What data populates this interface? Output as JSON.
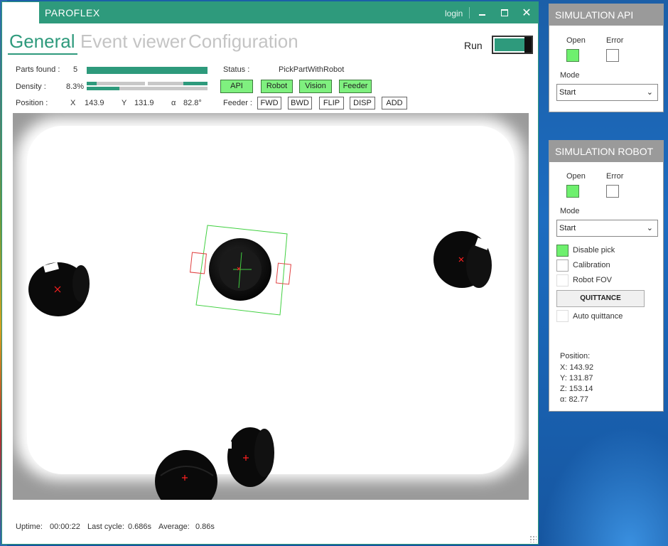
{
  "main_window": {
    "title": "PAROFLEX",
    "login_label": "login",
    "close_glyph": "✕"
  },
  "tabs": [
    {
      "label": "General",
      "active": true
    },
    {
      "label": "Event viewer",
      "active": false
    },
    {
      "label": "Configuration",
      "active": false
    }
  ],
  "run": {
    "label": "Run",
    "state": "on"
  },
  "stats": {
    "parts_found_label": "Parts found :",
    "parts_found_value": "5",
    "parts_found_level": 1.0,
    "density_label": "Density :",
    "density_value": "8.3%",
    "position_label": "Position :",
    "x_label": "X",
    "x_value": "143.9",
    "y_label": "Y",
    "y_value": "131.9",
    "a_label": "α",
    "a_value": "82.8°"
  },
  "status": {
    "label": "Status :",
    "value": "PickPartWithRobot",
    "indicators": [
      "API",
      "Robot",
      "Vision",
      "Feeder"
    ]
  },
  "feeder": {
    "label": "Feeder :",
    "buttons": [
      "FWD",
      "BWD",
      "FLIP",
      "DISP",
      "ADD"
    ]
  },
  "footer": {
    "uptime_label": "Uptime:",
    "uptime_value": "00:00:22",
    "last_cycle_label": "Last cycle:",
    "last_cycle_value": "0.686s",
    "average_label": "Average:",
    "average_value": "0.86s"
  },
  "sim_api": {
    "title": "SIMULATION API",
    "open_label": "Open",
    "open_state": "on",
    "error_label": "Error",
    "error_state": "off",
    "mode_label": "Mode",
    "mode_value": "Start"
  },
  "sim_robot": {
    "title": "SIMULATION ROBOT",
    "open_label": "Open",
    "open_state": "on",
    "error_label": "Error",
    "error_state": "off",
    "mode_label": "Mode",
    "mode_value": "Start",
    "checkboxes": [
      {
        "label": "Disable pick",
        "checked": true
      },
      {
        "label": "Calibration",
        "checked": false
      },
      {
        "label": "Robot FOV",
        "checked": false
      }
    ],
    "quittance_label": "QUITTANCE",
    "auto_quittance_label": "Auto quittance",
    "position_title": "Position:",
    "pos_x": "X: 143.92",
    "pos_y": "Y: 131.87",
    "pos_z": "Z: 153.14",
    "pos_a": "α: 82.77"
  },
  "colors": {
    "accent": "#2e9a7c",
    "indicator_on": "#6ef06e",
    "panel_header": "#9a9a9a",
    "target_marker": "#ff2020",
    "selection_box": "#40d040"
  }
}
